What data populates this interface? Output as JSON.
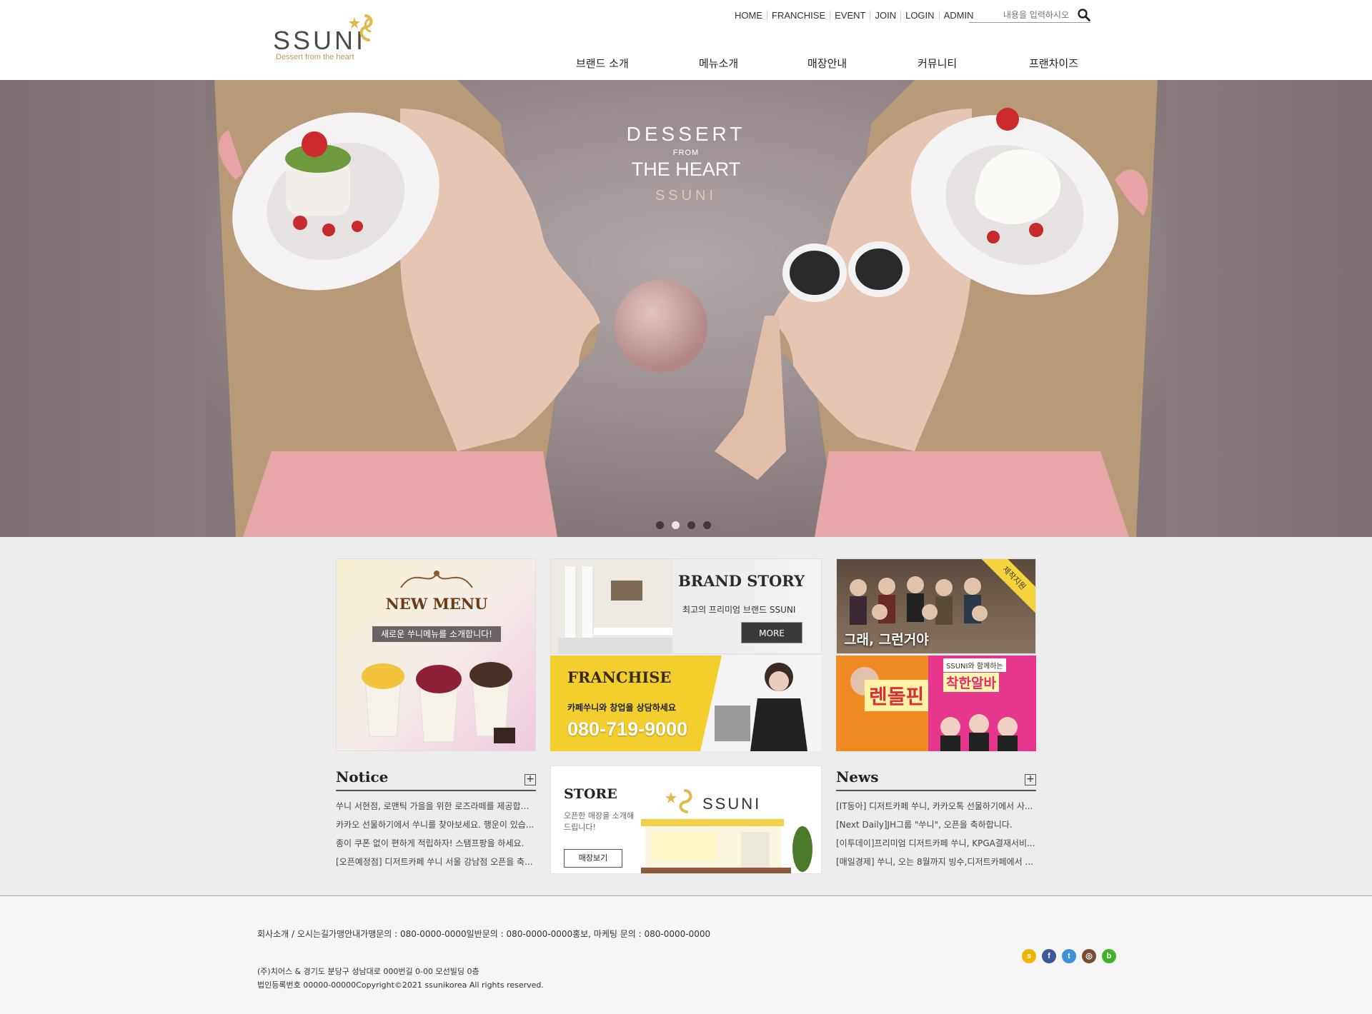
{
  "header": {
    "logo_text": "SSUNI",
    "logo_tagline": "Dessert from the heart",
    "util_links": [
      "HOME",
      "FRANCHISE",
      "EVENT",
      "JOIN",
      "LOGIN",
      "ADMIN"
    ],
    "search_placeholder": "내용을 입력하시오",
    "gnb": [
      "브랜드 소개",
      "메뉴소개",
      "매장안내",
      "커뮤니티",
      "프랜차이즈"
    ]
  },
  "hero": {
    "line1": "DESSERT",
    "line2": "FROM",
    "line3": "THE HEART",
    "line4": "SSUNI",
    "slide_count": 4,
    "active_slide": 2
  },
  "tiles": {
    "new_menu_title": "NEW MENU",
    "new_menu_sub": "새로운 쑤니메뉴를 소개합니다!",
    "brand_story_title": "BRAND STORY",
    "brand_story_sub": "최고의 프리미엄 브랜드 SSUNI",
    "brand_story_more": "MORE",
    "franchise_title": "FRANCHISE",
    "franchise_sub": "카페쑤니와 창업을 상담하세요",
    "franchise_phone": "080-719-9000",
    "drama_caption": "그래, 그런거야",
    "drama_ribbon": "제작지원",
    "show_title": "렌돌핀",
    "show_brand_note": "SSUNI와 함께하는",
    "show_sub": "착한알바"
  },
  "notice": {
    "title": "Notice",
    "items": [
      "쑤니 서현점, 로맨틱 가을을 위한 로즈라떼를 제공합니...",
      "카카오 선물하기에서 쑤니를 찾아보세요. 행운이 있습...",
      "종이 쿠폰 없이 편하게 적립하자! 스탬프팡을 하세요.",
      "[오픈예정점] 디저트카페 쑤니 서울 강남점 오픈을 축..."
    ]
  },
  "store": {
    "title": "STORE",
    "sub": "오픈한 매장을 소개해드립니다!",
    "button": "매장보기",
    "brand": "SSUNI"
  },
  "news": {
    "title": "News",
    "items": [
      "[IT동아] 디저트카페 쑤니, 카카오톡 선물하기에서 사...",
      "[Next Daily]JH그룹 \"쑤니\", 오픈을 축하합니다.",
      "[이투데이]프리미엄 디저트카페 쑤니, KPGA결재서비...",
      "[매일경제] 쑤니, 오는 8월까지 빙수,디저트카페에서 ..."
    ]
  },
  "footer": {
    "links": "회사소개 / 오시는길가맹안내가맹문의 : 080-0000-0000일반문의 : 080-0000-0000홍보, 마케팅 문의 : 080-0000-0000",
    "address": "(주)치어스 & 경기도 분당구 성남대로 000번길 0-00 모선빌딩 0층",
    "copyright": "법인등록번호 00000-00000Copyright©2021 ssunikorea All rights reserved.",
    "social_icons": [
      "kakaostory-icon",
      "facebook-icon",
      "twitter-icon",
      "instagram-icon",
      "blog-icon"
    ],
    "social_colors": [
      "#f2b300",
      "#3b5998",
      "#3d8fd8",
      "#7a4a36",
      "#43b12a"
    ],
    "social_glyphs": [
      "s",
      "f",
      "t",
      "◎",
      "b"
    ]
  }
}
